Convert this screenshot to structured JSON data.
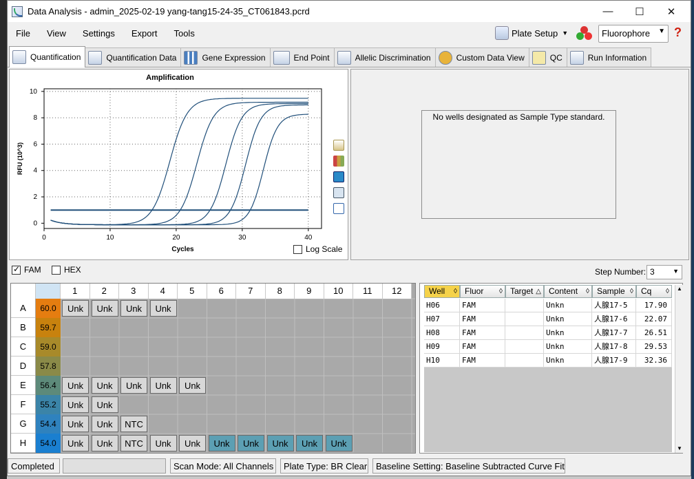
{
  "window": {
    "title": "Data Analysis - admin_2025-02-19 yang-tang15-24-35_CT061843.pcrd",
    "minimize": "—",
    "maximize": "☐",
    "close": "✕"
  },
  "menu": [
    "File",
    "View",
    "Settings",
    "Export",
    "Tools"
  ],
  "toolbar": {
    "plate_setup": "Plate Setup",
    "fluorophore": "Fluorophore",
    "help": "?"
  },
  "tabs": [
    {
      "label": "Quantification",
      "icon": "quantification-icon",
      "active": true
    },
    {
      "label": "Quantification Data",
      "icon": "quantification-data-icon",
      "active": false
    },
    {
      "label": "Gene Expression",
      "icon": "gene-expression-icon",
      "active": false
    },
    {
      "label": "End Point",
      "icon": "end-point-icon",
      "active": false
    },
    {
      "label": "Allelic Discrimination",
      "icon": "allelic-discrimination-icon",
      "active": false
    },
    {
      "label": "Custom Data View",
      "icon": "custom-data-view-icon",
      "active": false
    },
    {
      "label": "QC",
      "icon": "qc-icon",
      "active": false
    },
    {
      "label": "Run Information",
      "icon": "run-information-icon",
      "active": false
    }
  ],
  "chart_data": {
    "type": "line",
    "title": "Amplification",
    "xlabel": "Cycles",
    "ylabel": "RFU (10^3)",
    "xlim": [
      0,
      42
    ],
    "ylim": [
      -0.4,
      10.2
    ],
    "xticks": [
      0,
      10,
      20,
      30,
      40
    ],
    "yticks": [
      0,
      2,
      4,
      6,
      8,
      10
    ],
    "grid": true,
    "threshold": 1.0,
    "series": [
      {
        "well": "H06",
        "cq": 17.9,
        "plateau": 9.6,
        "slope": 1.05
      },
      {
        "well": "H07",
        "cq": 22.07,
        "plateau": 9.3,
        "slope": 1.1
      },
      {
        "well": "H08",
        "cq": 26.51,
        "plateau": 9.2,
        "slope": 1.15
      },
      {
        "well": "H09",
        "cq": 29.53,
        "plateau": 9.1,
        "slope": 1.2
      },
      {
        "well": "H10",
        "cq": 32.36,
        "plateau": 8.4,
        "slope": 1.3
      }
    ],
    "line_color": "#1f4e79",
    "log_scale_label": "Log Scale"
  },
  "standard_panel": {
    "message": "No wells designated as Sample Type standard."
  },
  "fluor_toggles": {
    "fam": "FAM",
    "fam_checked": true,
    "hex": "HEX",
    "hex_checked": false
  },
  "step": {
    "label": "Step Number:",
    "value": "3"
  },
  "plate": {
    "columns": [
      "1",
      "2",
      "3",
      "4",
      "5",
      "6",
      "7",
      "8",
      "9",
      "10",
      "11",
      "12"
    ],
    "rows": [
      {
        "row": "A",
        "temp": "60.0",
        "color": "#e57d10",
        "wells": [
          "Unk",
          "Unk",
          "Unk",
          "Unk"
        ],
        "teal": []
      },
      {
        "row": "B",
        "temp": "59.7",
        "color": "#c8820e",
        "wells": [],
        "teal": []
      },
      {
        "row": "C",
        "temp": "59.0",
        "color": "#a88a2a",
        "wells": [],
        "teal": []
      },
      {
        "row": "D",
        "temp": "57.8",
        "color": "#8a8a48",
        "wells": [],
        "teal": []
      },
      {
        "row": "E",
        "temp": "56.4",
        "color": "#5d8a7a",
        "wells": [
          "Unk",
          "Unk",
          "Unk",
          "Unk",
          "Unk"
        ],
        "teal": []
      },
      {
        "row": "F",
        "temp": "55.2",
        "color": "#3b84a8",
        "wells": [
          "Unk",
          "Unk"
        ],
        "teal": []
      },
      {
        "row": "G",
        "temp": "54.4",
        "color": "#2f82be",
        "wells": [
          "Unk",
          "Unk",
          "NTC"
        ],
        "teal": []
      },
      {
        "row": "H",
        "temp": "54.0",
        "color": "#1a7fd0",
        "wells": [
          "Unk",
          "Unk",
          "NTC",
          "Unk",
          "Unk",
          "Unk",
          "Unk",
          "Unk",
          "Unk",
          "Unk"
        ],
        "teal": [
          5,
          6,
          7,
          8,
          9
        ]
      }
    ]
  },
  "well_table": {
    "headers": [
      "Well",
      "Fluor",
      "Target",
      "Content",
      "Sample",
      "Cq"
    ],
    "rows": [
      [
        "H06",
        "FAM",
        "",
        "Unkn",
        "人腺17-5",
        "17.90"
      ],
      [
        "H07",
        "FAM",
        "",
        "Unkn",
        "人腺17-6",
        "22.07"
      ],
      [
        "H08",
        "FAM",
        "",
        "Unkn",
        "人腺17-7",
        "26.51"
      ],
      [
        "H09",
        "FAM",
        "",
        "Unkn",
        "人腺17-8",
        "29.53"
      ],
      [
        "H10",
        "FAM",
        "",
        "Unkn",
        "人腺17-9",
        "32.36"
      ]
    ]
  },
  "status": {
    "state": "Completed",
    "scan_mode": "Scan Mode: All Channels",
    "plate_type": "Plate Type: BR Clear",
    "baseline": "Baseline Setting: Baseline Subtracted Curve Fit"
  }
}
